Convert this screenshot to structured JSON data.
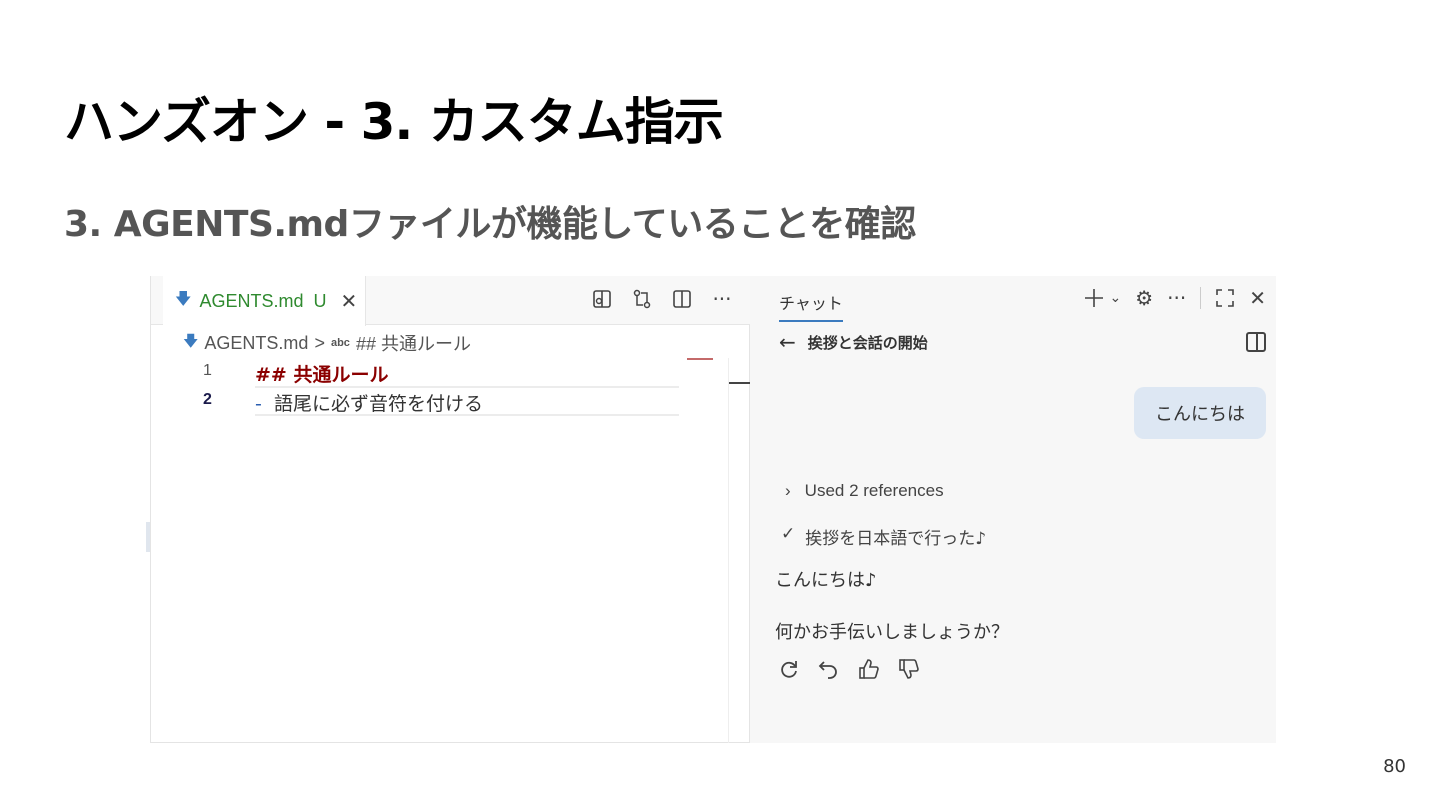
{
  "slide": {
    "title": "ハンズオン - 3. カスタム指示",
    "subtitle": "3.  AGENTS.mdファイルが機能していることを確認",
    "page_number": "80"
  },
  "editor": {
    "tab": {
      "label": "AGENTS.md",
      "status": "U",
      "icon": "markdown-download-icon"
    },
    "actions": [
      "open-preview-icon",
      "compare-changes-icon",
      "split-editor-icon",
      "more-icon"
    ],
    "breadcrumb": {
      "file": "AGENTS.md",
      "separator": ">",
      "symbol_badge": "abc",
      "section": "## 共通ルール"
    },
    "lines": [
      {
        "number": "1",
        "text": "##  共通ルール"
      },
      {
        "number": "2",
        "bullet": "-",
        "text": "語尾に必ず音符を付ける"
      }
    ]
  },
  "chat": {
    "tab": "チャット",
    "actions": [
      "new-chat-plus-icon",
      "chevron-down-icon",
      "settings-gear-icon",
      "more-icon",
      "maximize-icon",
      "close-icon"
    ],
    "header_title": "挨拶と会話の開始",
    "user_message": "こんにちは",
    "references": "Used 2 references",
    "done_step": "挨拶を日本語で行った♪",
    "reply_line1": "こんにちは♪",
    "reply_line2": "何かお手伝いしましょうか？",
    "feedback_actions": [
      "retry-icon",
      "undo-icon",
      "thumbs-up-icon",
      "thumbs-down-icon"
    ]
  },
  "colors": {
    "tab_green": "#2f8a2f",
    "heading_dark_red": "#8b0000",
    "markdown_icon_blue": "#3b7bbf",
    "user_bubble": "#dde7f3",
    "chat_background": "#f7f7f7"
  }
}
